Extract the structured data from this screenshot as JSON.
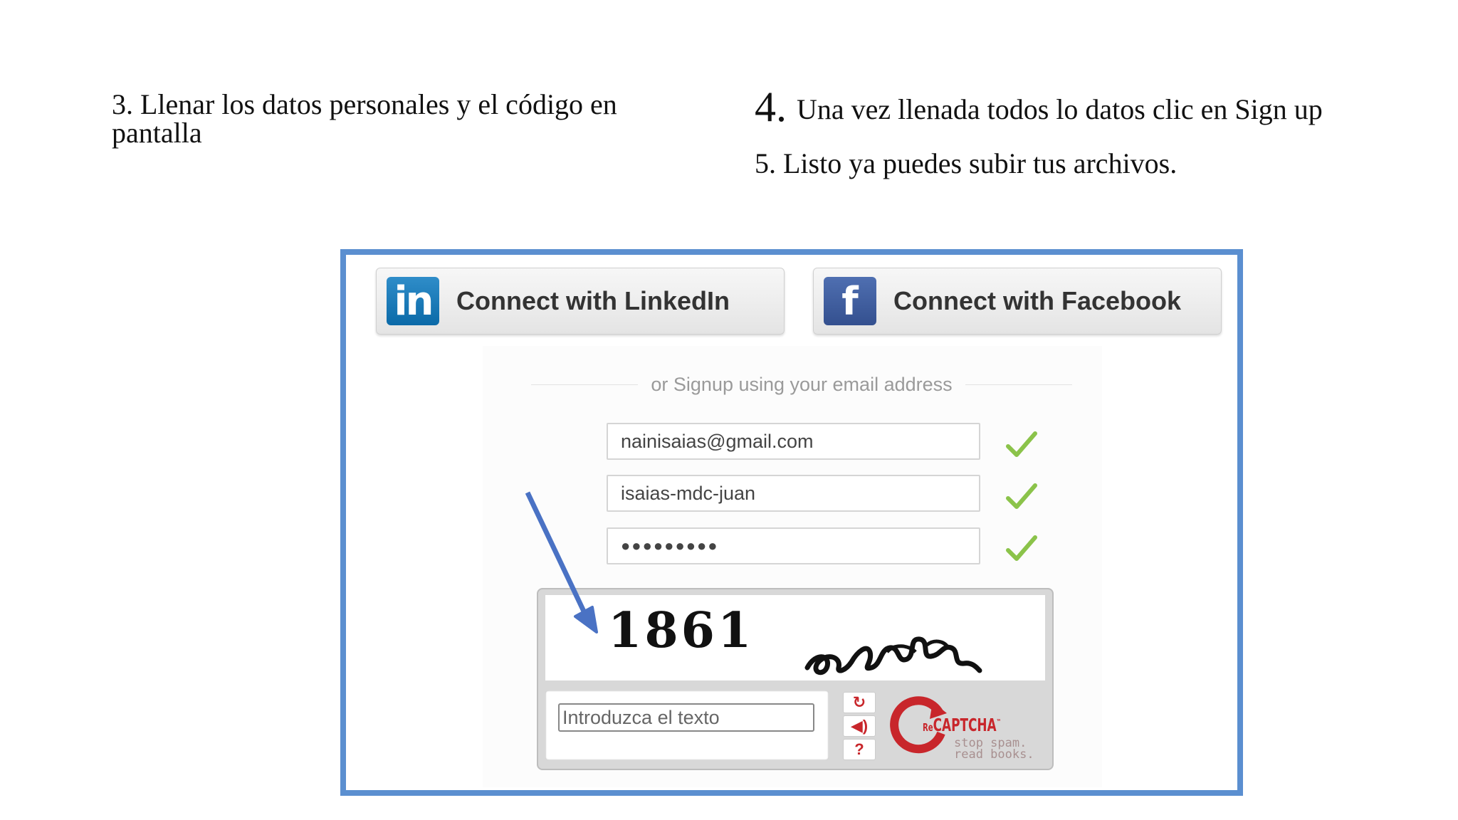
{
  "instructions": {
    "step3": "3. Llenar los datos personales y el código en pantalla",
    "step4_number": "4.",
    "step4_text": "Una vez llenada todos lo datos clic en Sign up",
    "step5": "5. Listo ya puedes subir tus archivos."
  },
  "signup": {
    "linkedin_label": "Connect with LinkedIn",
    "linkedin_logo": "in",
    "facebook_label": "Connect with Facebook",
    "facebook_logo": "f",
    "divider_text": "or Signup using your email address",
    "email_value": "nainisaias@gmail.com",
    "username_value": "isaias-mdc-juan",
    "password_value": "●●●●●●●●●"
  },
  "recaptcha": {
    "challenge_number": "1861",
    "input_placeholder": "Introduzca el texto",
    "reload_icon": "↻",
    "audio_icon": "◀)",
    "help_icon": "?",
    "brand_prefix": "Re",
    "brand": "CAPTCHA",
    "tm": "™",
    "tagline_1": "stop spam.",
    "tagline_2": "read books."
  },
  "colors": {
    "frame_border": "#5b8fd0",
    "check": "#8bc34a",
    "arrow": "#4a72c4",
    "recaptcha_red": "#c8262b"
  }
}
